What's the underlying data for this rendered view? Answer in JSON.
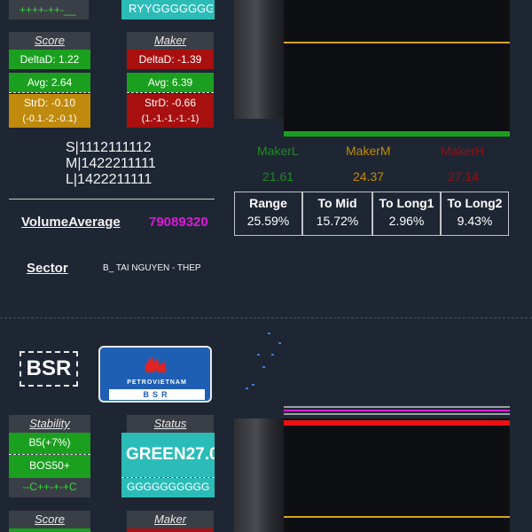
{
  "top_strip": {
    "left_text": "++++-++-__",
    "right_text": "RYYGGGGGGG"
  },
  "score_card": {
    "title": "Score",
    "delta": "DeltaD: 1.22",
    "avg": "Avg: 2.64",
    "strd": "StrD: -0.10",
    "seq": "(-0.1.-2.-0.1)"
  },
  "maker_card": {
    "title": "Maker",
    "delta": "DeltaD: -1.39",
    "avg": "Avg: 6.39",
    "strd": "StrD: -0.66",
    "seq": "(1.-1.-1.-1.-1)"
  },
  "slm_lines": {
    "s": "S|1112111112",
    "m": "M|1422211111",
    "l": "L|1422211111"
  },
  "volume": {
    "label": "VolumeAverage",
    "value": "79089320"
  },
  "sector": {
    "label": "Sector",
    "value": "B_ TAI NGUYEN - THEP"
  },
  "makers": {
    "l_label": "MakerL",
    "l_value": "21.61",
    "m_label": "MakerM",
    "m_value": "24.37",
    "h_label": "MakerH",
    "h_value": "27.14"
  },
  "range_table": {
    "headers": [
      "Range",
      "To Mid",
      "To Long1",
      "To Long2"
    ],
    "values": [
      "25.59%",
      "15.72%",
      "2.96%",
      "9.43%"
    ]
  },
  "ticker2": {
    "symbol": "BSR",
    "logo_brand": "PETROVIETNAM",
    "logo_sub": "BSR"
  },
  "stability_card": {
    "title": "Stability",
    "line1": "B5(+7%)",
    "line2": "BOS50+",
    "line3": "--C++-+-+C"
  },
  "status_card": {
    "title": "Status",
    "big": "GREEN27.0",
    "seq": "GGGGGGGGGG"
  },
  "bottom_cards": {
    "score_title": "Score",
    "maker_title": "Maker"
  },
  "colors": {
    "bg": "#1f2633",
    "green": "#1aa01e",
    "red": "#a81010",
    "gold": "#c08a0c",
    "teal": "#2bbcb8",
    "magenta": "#d81ad8"
  }
}
